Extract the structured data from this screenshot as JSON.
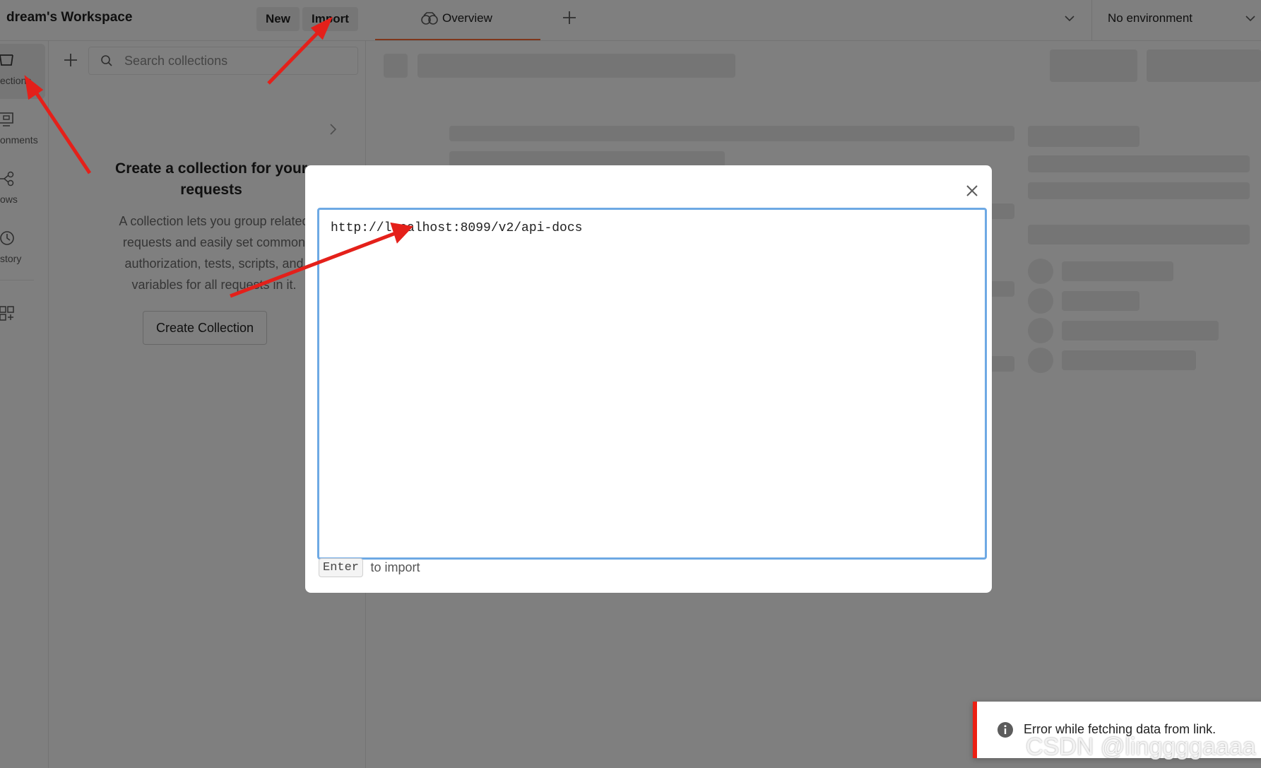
{
  "header": {
    "workspace_title": "dream's Workspace",
    "new_label": "New",
    "import_label": "Import",
    "tabs": [
      {
        "label": "Overview",
        "icon": "overview-icon",
        "active": true
      }
    ],
    "environment_label": "No environment"
  },
  "rail": {
    "items": [
      {
        "label": "ections",
        "icon": "collections-icon",
        "active": true
      },
      {
        "label": "onments",
        "icon": "environments-icon",
        "active": false
      },
      {
        "label": "ows",
        "icon": "flows-icon",
        "active": false
      },
      {
        "label": "story",
        "icon": "history-icon",
        "active": false
      },
      {
        "label": "",
        "icon": "add-apps-icon",
        "active": false
      }
    ]
  },
  "sidebar": {
    "search_placeholder": "Search collections",
    "empty_title": "Create a collection for your requests",
    "empty_description": "A collection lets you group related requests and easily set common authorization, tests, scripts, and variables for all requests in it.",
    "create_button_label": "Create Collection"
  },
  "modal": {
    "link_value": "http://localhost:8099/v2/api-docs",
    "hint_key": "Enter",
    "hint_text": "to import"
  },
  "toast": {
    "message": "Error while fetching data from link.",
    "icon": "info-icon",
    "accent_color": "#eb2013"
  },
  "watermark": "CSDN @linggggaaaa",
  "colors": {
    "overlay": "rgba(0,0,0,0.5)",
    "input_focus_border": "#6ea9e4",
    "tab_active_underline": "#ff6c37",
    "annotation_arrow": "#e4201a"
  }
}
